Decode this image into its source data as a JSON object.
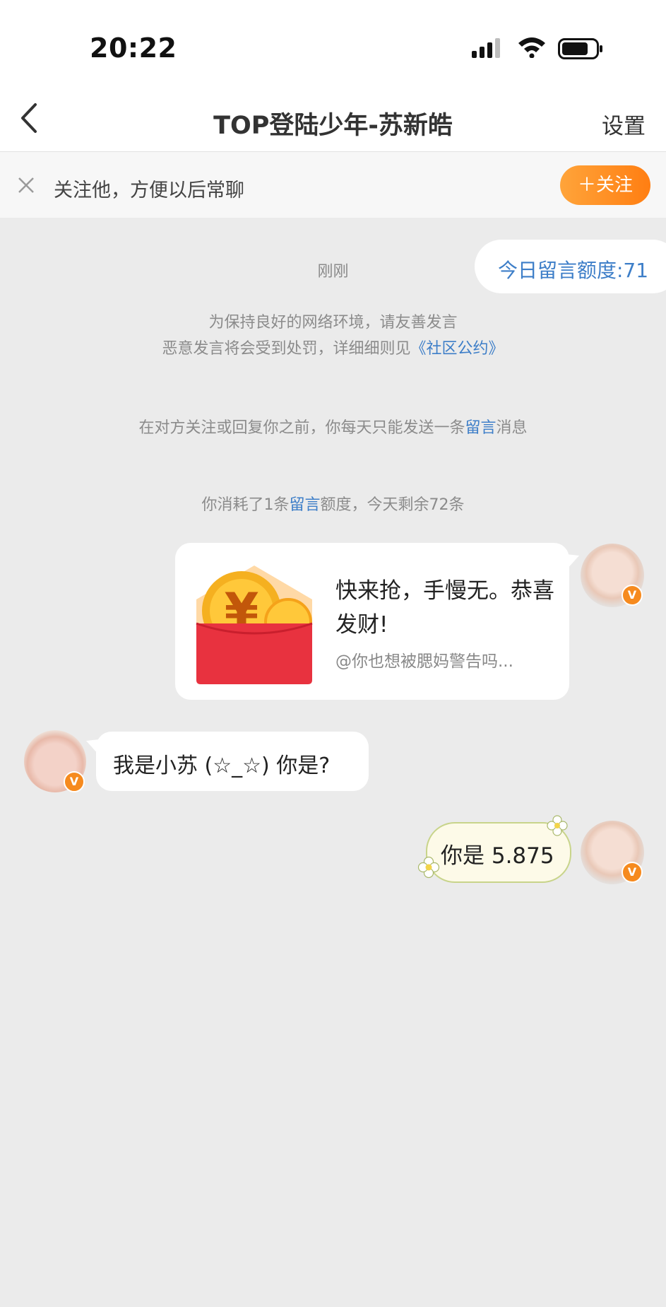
{
  "status_bar": {
    "time": "20:22",
    "icons": [
      "signal-icon",
      "wifi-icon",
      "battery-icon"
    ]
  },
  "nav": {
    "title": "TOP登陆少年-苏新皓",
    "settings_label": "设置",
    "back_icon": "chevron-left-icon"
  },
  "follow_bar": {
    "text": "关注他，方便以后常聊",
    "button_label": "＋关注",
    "button_color": "#ff8a1f"
  },
  "quota_chip": {
    "text": "今日留言额度:71"
  },
  "system_messages": {
    "timestamp": "刚刚",
    "notice_line1": "为保持良好的网络环境，请友善发言",
    "notice_line2_prefix": "恶意发言将会受到处罚，详细细则见",
    "notice_line2_link": "《社区公约》",
    "limit_prefix": "在对方关注或回复你之前，你每天只能发送一条",
    "limit_link": "留言",
    "limit_suffix": "消息",
    "consume_prefix": "你消耗了1条",
    "consume_link": "留言",
    "consume_suffix": "额度，今天剩余72条"
  },
  "messages": [
    {
      "sender": "me",
      "type": "red-packet",
      "title": "快来抢，手慢无。恭喜发财!",
      "subtitle": "@你也想被腮妈警告吗..."
    },
    {
      "sender": "other",
      "type": "text",
      "text": "我是小苏 (☆_☆) 你是?"
    },
    {
      "sender": "me",
      "type": "text",
      "text": "你是 5.875"
    }
  ],
  "badge_letter": "V",
  "colors": {
    "accent_orange": "#ff8a1f",
    "link_blue": "#3d7ec8",
    "background": "#ebebeb",
    "red_packet": "#e8323f"
  }
}
